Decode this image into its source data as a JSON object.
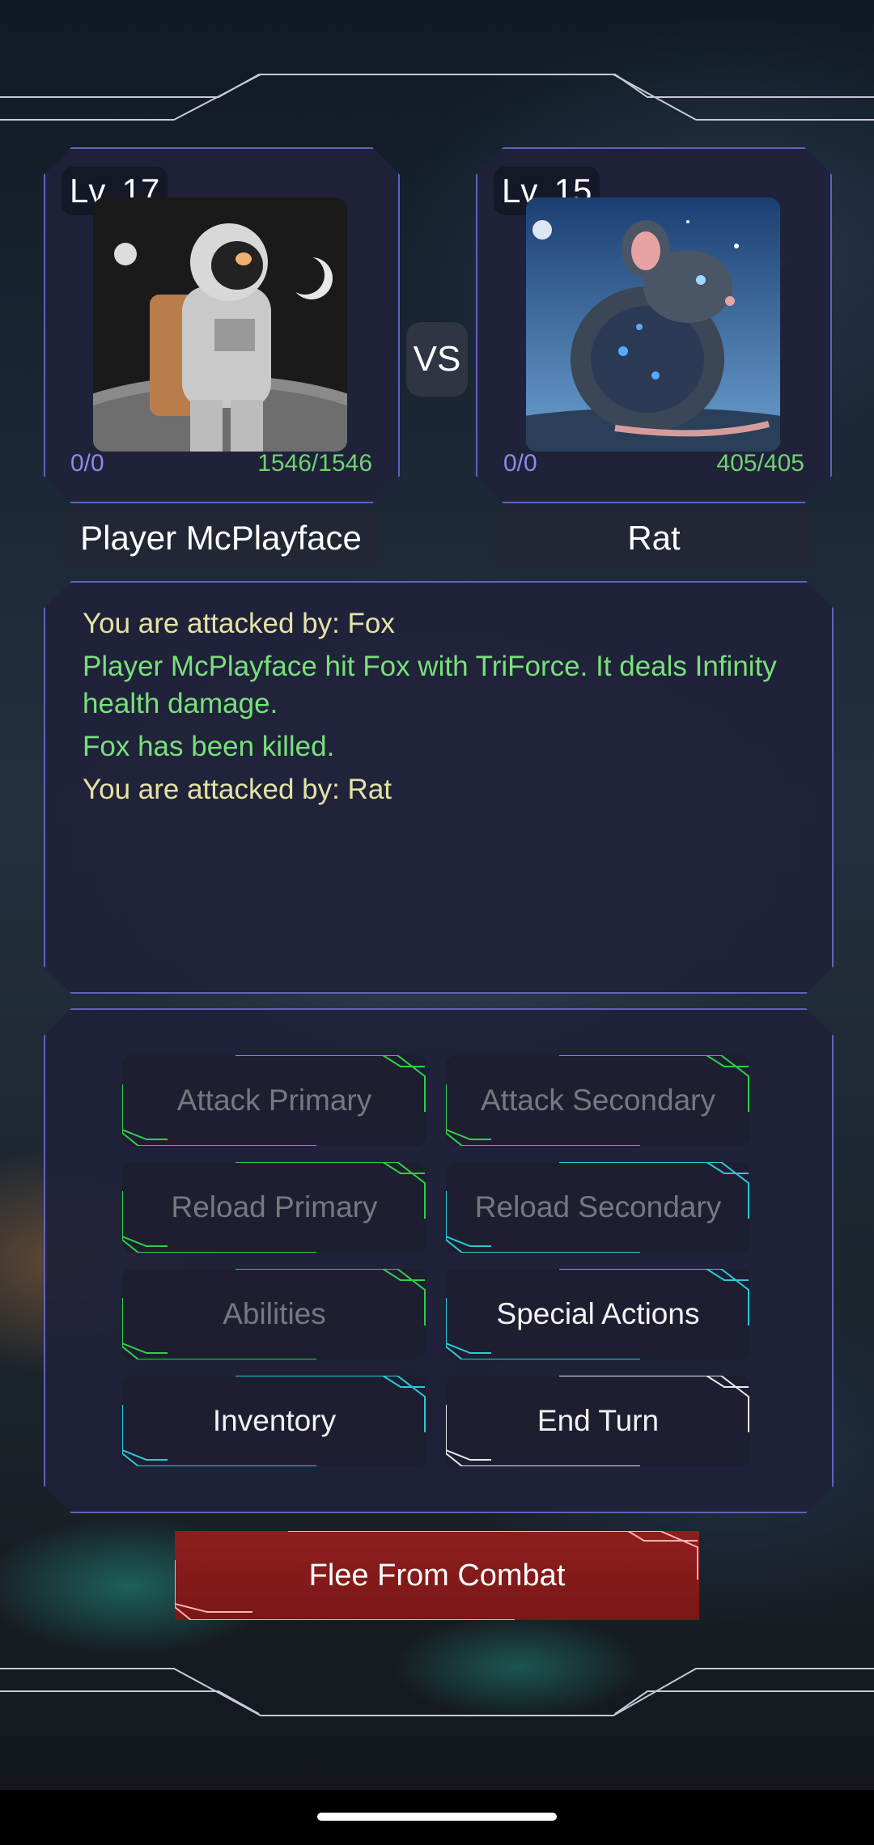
{
  "player": {
    "level": "Lv. 17",
    "name": "Player McPlayface",
    "energy": "0/0",
    "health": "1546/1546"
  },
  "enemy": {
    "level": "Lv. 15",
    "name": "Rat",
    "energy": "0/0",
    "health": "405/405"
  },
  "vs_label": "VS",
  "combat_log": [
    {
      "text": "You are attacked by: Fox",
      "color": "#e6e2a3"
    },
    {
      "text": "Player McPlayface hit Fox with TriForce. It deals Infinity health damage.",
      "color": "#78e07a"
    },
    {
      "text": "Fox has been killed.",
      "color": "#78e07a"
    },
    {
      "text": "You are attacked by: Rat",
      "color": "#e6e2a3"
    }
  ],
  "actions": {
    "attack_primary": "Attack Primary",
    "attack_secondary": "Attack Secondary",
    "reload_primary": "Reload Primary",
    "reload_secondary": "Reload Secondary",
    "abilities": "Abilities",
    "special_actions": "Special Actions",
    "inventory": "Inventory",
    "end_turn": "End Turn"
  },
  "flee_label": "Flee From Combat",
  "colors": {
    "accent_green": "#2fd04a",
    "accent_cyan": "#2ec8d8",
    "accent_white": "#e8e8f0",
    "frame_purple": "#7878e6",
    "flee_red": "#8e1e1e"
  }
}
